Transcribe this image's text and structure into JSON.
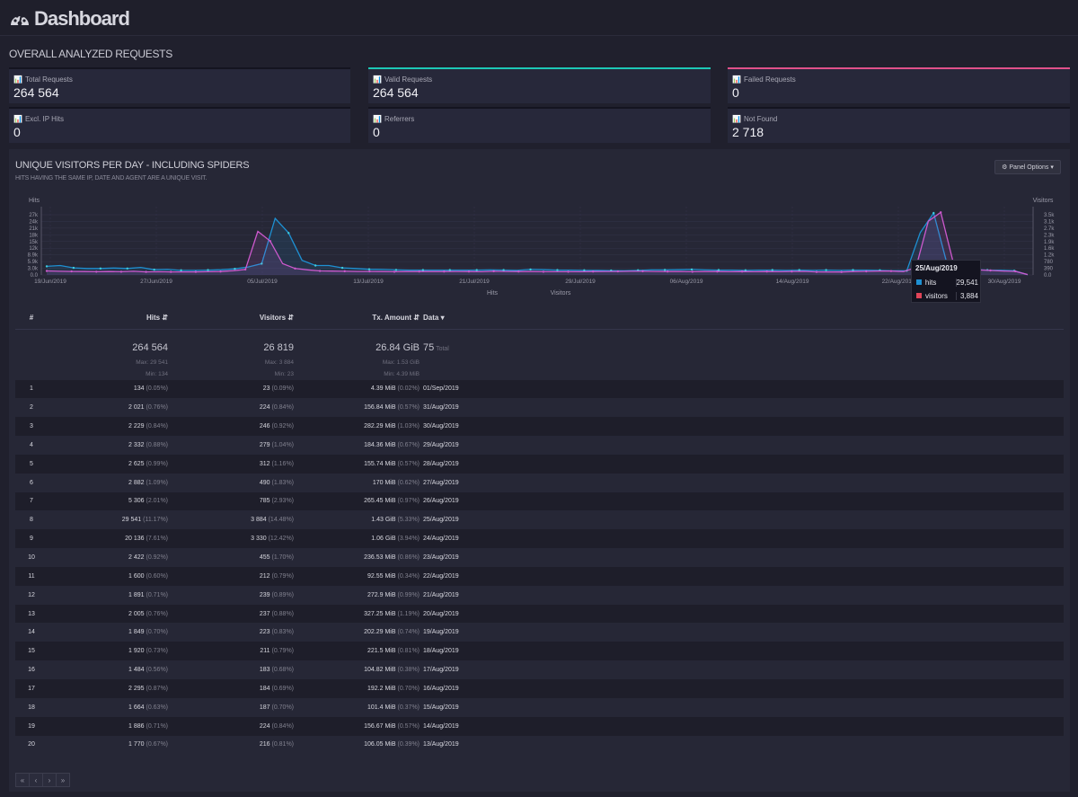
{
  "header": {
    "title": "Dashboard",
    "icon": "dashboard-gauge-icon"
  },
  "overall": {
    "title": "OVERALL ANALYZED REQUESTS",
    "cards": [
      {
        "label": "Total Requests",
        "value": "264 564",
        "accent": "#141420"
      },
      {
        "label": "Valid Requests",
        "value": "264 564",
        "accent": "#1dc8b6"
      },
      {
        "label": "Failed Requests",
        "value": "0",
        "accent": "#e0518a"
      },
      {
        "label": "Excl. IP Hits",
        "value": "0"
      },
      {
        "label": "Referrers",
        "value": "0"
      },
      {
        "label": "Not Found",
        "value": "2 718"
      }
    ]
  },
  "panel": {
    "title": "UNIQUE VISITORS PER DAY - INCLUDING SPIDERS",
    "subtitle": "HITS HAVING THE SAME IP, DATE AND AGENT ARE A UNIQUE VISIT.",
    "options_label": "Panel Options",
    "legend": {
      "hits": "Hits",
      "visitors": "Visitors"
    }
  },
  "chart_data": {
    "type": "line",
    "y_left_label": "Hits",
    "y_right_label": "Visitors",
    "y_left_ticks": [
      "27k",
      "24k",
      "21k",
      "18k",
      "15k",
      "12k",
      "8.9k",
      "5.9k",
      "3.0k",
      "0.0"
    ],
    "y_right_ticks": [
      "3.5k",
      "3.1k",
      "2.7k",
      "2.3k",
      "1.9k",
      "1.6k",
      "1.2k",
      "780",
      "390",
      "0.0"
    ],
    "x_ticks": [
      "19/Jun/2019",
      "27/Jun/2019",
      "05/Jul/2019",
      "13/Jul/2019",
      "21/Jul/2019",
      "29/Jul/2019",
      "06/Aug/2019",
      "14/Aug/2019",
      "22/Aug/2019",
      "30/Aug/2019"
    ],
    "series": [
      {
        "name": "hits",
        "color": "#1e90d2",
        "values": [
          4100,
          4500,
          3400,
          3100,
          3100,
          3300,
          3100,
          3600,
          2500,
          2600,
          2200,
          2200,
          2300,
          2500,
          2900,
          3800,
          5400,
          27000,
          20000,
          7000,
          4500,
          4500,
          3400,
          3100,
          2700,
          2600,
          2400,
          2300,
          2300,
          2300,
          2300,
          2300,
          2300,
          2400,
          2300,
          2200,
          2600,
          2500,
          2300,
          2300,
          2200,
          2200,
          2100,
          2000,
          2200,
          2400,
          2400,
          2500,
          2600,
          2400,
          2300,
          2300,
          2200,
          2300,
          2300,
          2200,
          2300,
          2200,
          2300,
          2200,
          2300,
          2300,
          2200,
          2000,
          2000,
          20136,
          29541,
          5306,
          2882,
          2625,
          2332,
          2229,
          2021,
          134
        ]
      },
      {
        "name": "visitors",
        "color": "#cc59cd",
        "values": [
          250,
          230,
          220,
          210,
          200,
          210,
          200,
          230,
          190,
          200,
          190,
          190,
          190,
          200,
          210,
          260,
          340,
          2700,
          2100,
          700,
          400,
          320,
          250,
          240,
          230,
          220,
          220,
          210,
          200,
          210,
          210,
          210,
          210,
          220,
          210,
          200,
          230,
          220,
          210,
          210,
          200,
          200,
          200,
          200,
          210,
          220,
          220,
          230,
          230,
          220,
          210,
          210,
          200,
          210,
          210,
          200,
          210,
          200,
          210,
          200,
          216,
          224,
          187,
          184,
          183,
          211,
          223,
          237,
          239,
          212,
          455,
          3330,
          3884,
          785,
          490,
          312,
          279,
          246,
          224,
          23
        ]
      }
    ],
    "tooltip": {
      "date": "25/Aug/2019",
      "hits": "29,541",
      "visitors": "3,884"
    }
  },
  "table": {
    "headers": {
      "num": "#",
      "hits": "Hits",
      "visitors": "Visitors",
      "tx": "Tx. Amount",
      "date": "Data"
    },
    "summary": {
      "hits": "264 564",
      "hits_max": "Max: 29 541",
      "hits_min": "Min: 134",
      "visitors": "26 819",
      "visitors_max": "Max: 3 884",
      "visitors_min": "Min: 23",
      "tx": "26.84 GiB",
      "tx_max": "Max: 1.53 GiB",
      "tx_min": "Min: 4.39 MiB",
      "total": "75",
      "total_label": "Total"
    },
    "rows": [
      {
        "n": "1",
        "hits": "134",
        "hp": "(0.05%)",
        "vis": "23",
        "vp": "(0.09%)",
        "tx": "4.39 MiB",
        "tp": "(0.02%)",
        "date": "01/Sep/2019"
      },
      {
        "n": "2",
        "hits": "2 021",
        "hp": "(0.76%)",
        "vis": "224",
        "vp": "(0.84%)",
        "tx": "156.84 MiB",
        "tp": "(0.57%)",
        "date": "31/Aug/2019"
      },
      {
        "n": "3",
        "hits": "2 229",
        "hp": "(0.84%)",
        "vis": "246",
        "vp": "(0.92%)",
        "tx": "282.29 MiB",
        "tp": "(1.03%)",
        "date": "30/Aug/2019"
      },
      {
        "n": "4",
        "hits": "2 332",
        "hp": "(0.88%)",
        "vis": "279",
        "vp": "(1.04%)",
        "tx": "184.36 MiB",
        "tp": "(0.67%)",
        "date": "29/Aug/2019"
      },
      {
        "n": "5",
        "hits": "2 625",
        "hp": "(0.99%)",
        "vis": "312",
        "vp": "(1.16%)",
        "tx": "155.74 MiB",
        "tp": "(0.57%)",
        "date": "28/Aug/2019"
      },
      {
        "n": "6",
        "hits": "2 882",
        "hp": "(1.09%)",
        "vis": "490",
        "vp": "(1.83%)",
        "tx": "170 MiB",
        "tp": "(0.62%)",
        "date": "27/Aug/2019"
      },
      {
        "n": "7",
        "hits": "5 306",
        "hp": "(2.01%)",
        "vis": "785",
        "vp": "(2.93%)",
        "tx": "265.45 MiB",
        "tp": "(0.97%)",
        "date": "26/Aug/2019"
      },
      {
        "n": "8",
        "hits": "29 541",
        "hp": "(11.17%)",
        "vis": "3 884",
        "vp": "(14.48%)",
        "tx": "1.43 GiB",
        "tp": "(5.33%)",
        "date": "25/Aug/2019"
      },
      {
        "n": "9",
        "hits": "20 136",
        "hp": "(7.61%)",
        "vis": "3 330",
        "vp": "(12.42%)",
        "tx": "1.06 GiB",
        "tp": "(3.94%)",
        "date": "24/Aug/2019"
      },
      {
        "n": "10",
        "hits": "2 422",
        "hp": "(0.92%)",
        "vis": "455",
        "vp": "(1.70%)",
        "tx": "236.53 MiB",
        "tp": "(0.86%)",
        "date": "23/Aug/2019"
      },
      {
        "n": "11",
        "hits": "1 600",
        "hp": "(0.60%)",
        "vis": "212",
        "vp": "(0.79%)",
        "tx": "92.55 MiB",
        "tp": "(0.34%)",
        "date": "22/Aug/2019"
      },
      {
        "n": "12",
        "hits": "1 891",
        "hp": "(0.71%)",
        "vis": "239",
        "vp": "(0.89%)",
        "tx": "272.9 MiB",
        "tp": "(0.99%)",
        "date": "21/Aug/2019"
      },
      {
        "n": "13",
        "hits": "2 005",
        "hp": "(0.76%)",
        "vis": "237",
        "vp": "(0.88%)",
        "tx": "327.25 MiB",
        "tp": "(1.19%)",
        "date": "20/Aug/2019"
      },
      {
        "n": "14",
        "hits": "1 849",
        "hp": "(0.70%)",
        "vis": "223",
        "vp": "(0.83%)",
        "tx": "202.29 MiB",
        "tp": "(0.74%)",
        "date": "19/Aug/2019"
      },
      {
        "n": "15",
        "hits": "1 920",
        "hp": "(0.73%)",
        "vis": "211",
        "vp": "(0.79%)",
        "tx": "221.5 MiB",
        "tp": "(0.81%)",
        "date": "18/Aug/2019"
      },
      {
        "n": "16",
        "hits": "1 484",
        "hp": "(0.56%)",
        "vis": "183",
        "vp": "(0.68%)",
        "tx": "104.82 MiB",
        "tp": "(0.38%)",
        "date": "17/Aug/2019"
      },
      {
        "n": "17",
        "hits": "2 295",
        "hp": "(0.87%)",
        "vis": "184",
        "vp": "(0.69%)",
        "tx": "192.2 MiB",
        "tp": "(0.70%)",
        "date": "16/Aug/2019"
      },
      {
        "n": "18",
        "hits": "1 664",
        "hp": "(0.63%)",
        "vis": "187",
        "vp": "(0.70%)",
        "tx": "101.4 MiB",
        "tp": "(0.37%)",
        "date": "15/Aug/2019"
      },
      {
        "n": "19",
        "hits": "1 886",
        "hp": "(0.71%)",
        "vis": "224",
        "vp": "(0.84%)",
        "tx": "156.67 MiB",
        "tp": "(0.57%)",
        "date": "14/Aug/2019"
      },
      {
        "n": "20",
        "hits": "1 770",
        "hp": "(0.67%)",
        "vis": "216",
        "vp": "(0.81%)",
        "tx": "106.05 MiB",
        "tp": "(0.39%)",
        "date": "13/Aug/2019"
      }
    ]
  },
  "pager": {
    "first": "«",
    "prev": "‹",
    "next": "›",
    "last": "»"
  }
}
